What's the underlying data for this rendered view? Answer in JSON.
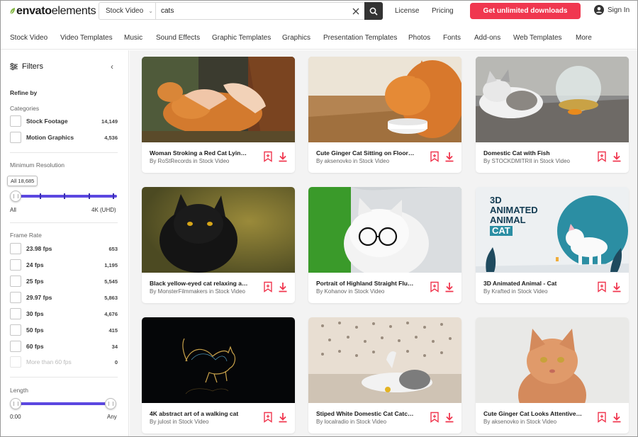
{
  "brand": {
    "logo_bold": "envato",
    "logo_light": "elements",
    "accent": "#f0374f",
    "slider_color": "#5b47e0",
    "leaf_color": "#82b541"
  },
  "search": {
    "category": "Stock Video",
    "query": "cats",
    "clear_icon": "close-icon",
    "search_icon": "search-icon"
  },
  "header": {
    "license": "License",
    "pricing": "Pricing",
    "cta": "Get unlimited downloads",
    "signin": "Sign In"
  },
  "nav": [
    "Stock Video",
    "Video Templates",
    "Music",
    "Sound Effects",
    "Graphic Templates",
    "Graphics",
    "Presentation Templates",
    "Photos",
    "Fonts",
    "Add-ons",
    "Web Templates",
    "More"
  ],
  "sidebar": {
    "title": "Filters",
    "refine_by": "Refine by",
    "categories_head": "Categories",
    "categories": [
      {
        "label": "Stock Footage",
        "count": "14,149"
      },
      {
        "label": "Motion Graphics",
        "count": "4,536"
      }
    ],
    "resolution_head": "Minimum Resolution",
    "resolution_tooltip": "All 18,685",
    "resolution_min": "All",
    "resolution_max": "4K (UHD)",
    "framerate_head": "Frame Rate",
    "framerates": [
      {
        "label": "23.98 fps",
        "count": "653"
      },
      {
        "label": "24 fps",
        "count": "1,195"
      },
      {
        "label": "25 fps",
        "count": "5,545"
      },
      {
        "label": "29.97 fps",
        "count": "5,863"
      },
      {
        "label": "30 fps",
        "count": "4,676"
      },
      {
        "label": "50 fps",
        "count": "415"
      },
      {
        "label": "60 fps",
        "count": "34"
      },
      {
        "label": "More than 60 fps",
        "count": "0",
        "disabled": true
      }
    ],
    "length_head": "Length",
    "length_min": "0:00",
    "length_max": "Any"
  },
  "cards": [
    {
      "title": "Woman Stroking a Red Cat Lying ...",
      "author": "By RoStRecords in Stock Video"
    },
    {
      "title": "Cute Ginger Cat Sitting on Floor a...",
      "author": "By aksenovko in Stock Video"
    },
    {
      "title": "Domestic Cat with Fish",
      "author": "By STOCKDMITRII in Stock Video"
    },
    {
      "title": "Black yellow-eyed cat relaxing an...",
      "author": "By MonsterFilmmakers in Stock Video"
    },
    {
      "title": "Portrait of Highland Straight Fluff...",
      "author": "By Kohanov in Stock Video"
    },
    {
      "title": "3D Animated Animal - Cat",
      "author": "By Krafted in Stock Video",
      "thumb_text": [
        "3D",
        "ANIMATED",
        "ANIMAL",
        "CAT"
      ]
    },
    {
      "title": "4K abstract art of a walking cat",
      "author": "By julost in Stock Video"
    },
    {
      "title": "Stiped White Domestic Cat Catchi...",
      "author": "By localradio in Stock Video"
    },
    {
      "title": "Cute Ginger Cat Looks Attentively...",
      "author": "By aksenovko in Stock Video"
    }
  ]
}
